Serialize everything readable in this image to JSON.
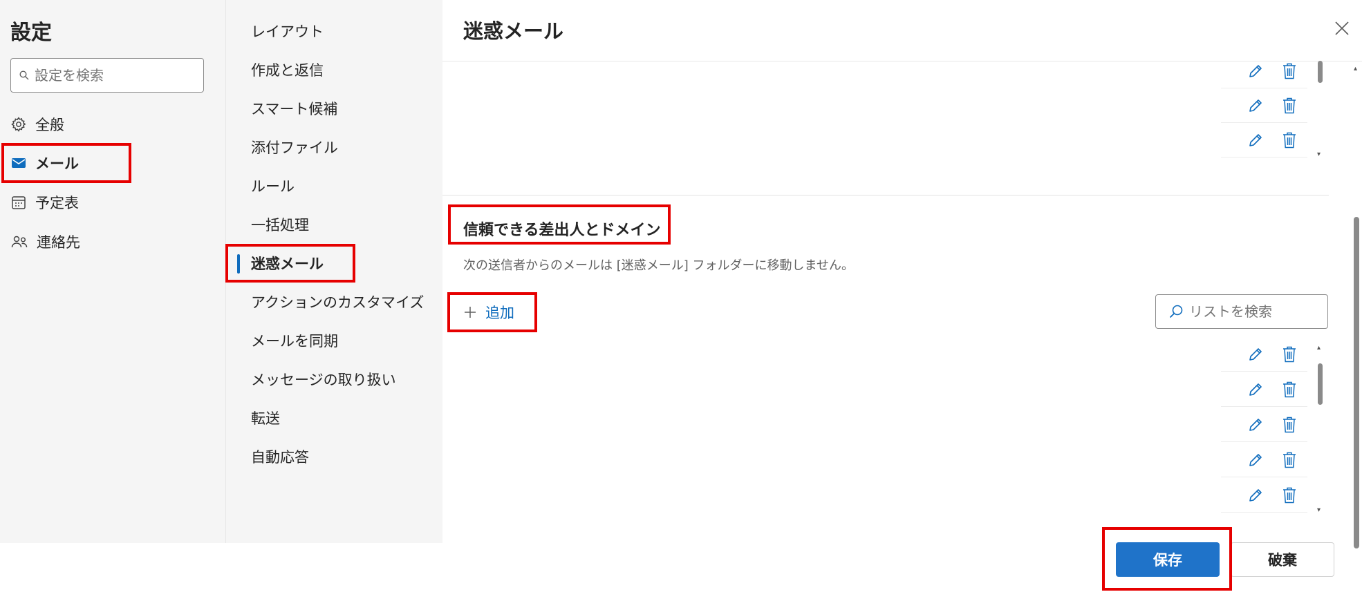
{
  "settings_title": "設定",
  "search": {
    "placeholder": "設定を検索"
  },
  "nav": {
    "items": [
      {
        "label": "全般",
        "icon": "gear-icon"
      },
      {
        "label": "メール",
        "icon": "mail-icon"
      },
      {
        "label": "予定表",
        "icon": "calendar-icon"
      },
      {
        "label": "連絡先",
        "icon": "people-icon"
      }
    ],
    "selected": "メール"
  },
  "subnav": {
    "items": [
      "レイアウト",
      "作成と返信",
      "スマート候補",
      "添付ファイル",
      "ルール",
      "一括処理",
      "迷惑メール",
      "アクションのカスタマイズ",
      "メールを同期",
      "メッセージの取り扱い",
      "転送",
      "自動応答"
    ],
    "selected": "迷惑メール"
  },
  "main": {
    "title": "迷惑メール",
    "blocked_list": {
      "rows": 3,
      "row_icons": [
        "pencil-icon",
        "trash-icon"
      ]
    },
    "trusted": {
      "title": "信頼できる差出人とドメイン",
      "description": "次の送信者からのメールは [迷惑メール] フォルダーに移動しません。",
      "add_label": "追加",
      "search_placeholder": "リストを検索",
      "rows": 5,
      "row_icons": [
        "pencil-icon",
        "trash-icon"
      ]
    },
    "save_label": "保存",
    "discard_label": "破棄"
  },
  "colors": {
    "accent": "#0f6cbd",
    "save_button": "#1f73c9",
    "annotation": "#e60000",
    "sidebar_bg": "#f5f5f5"
  }
}
